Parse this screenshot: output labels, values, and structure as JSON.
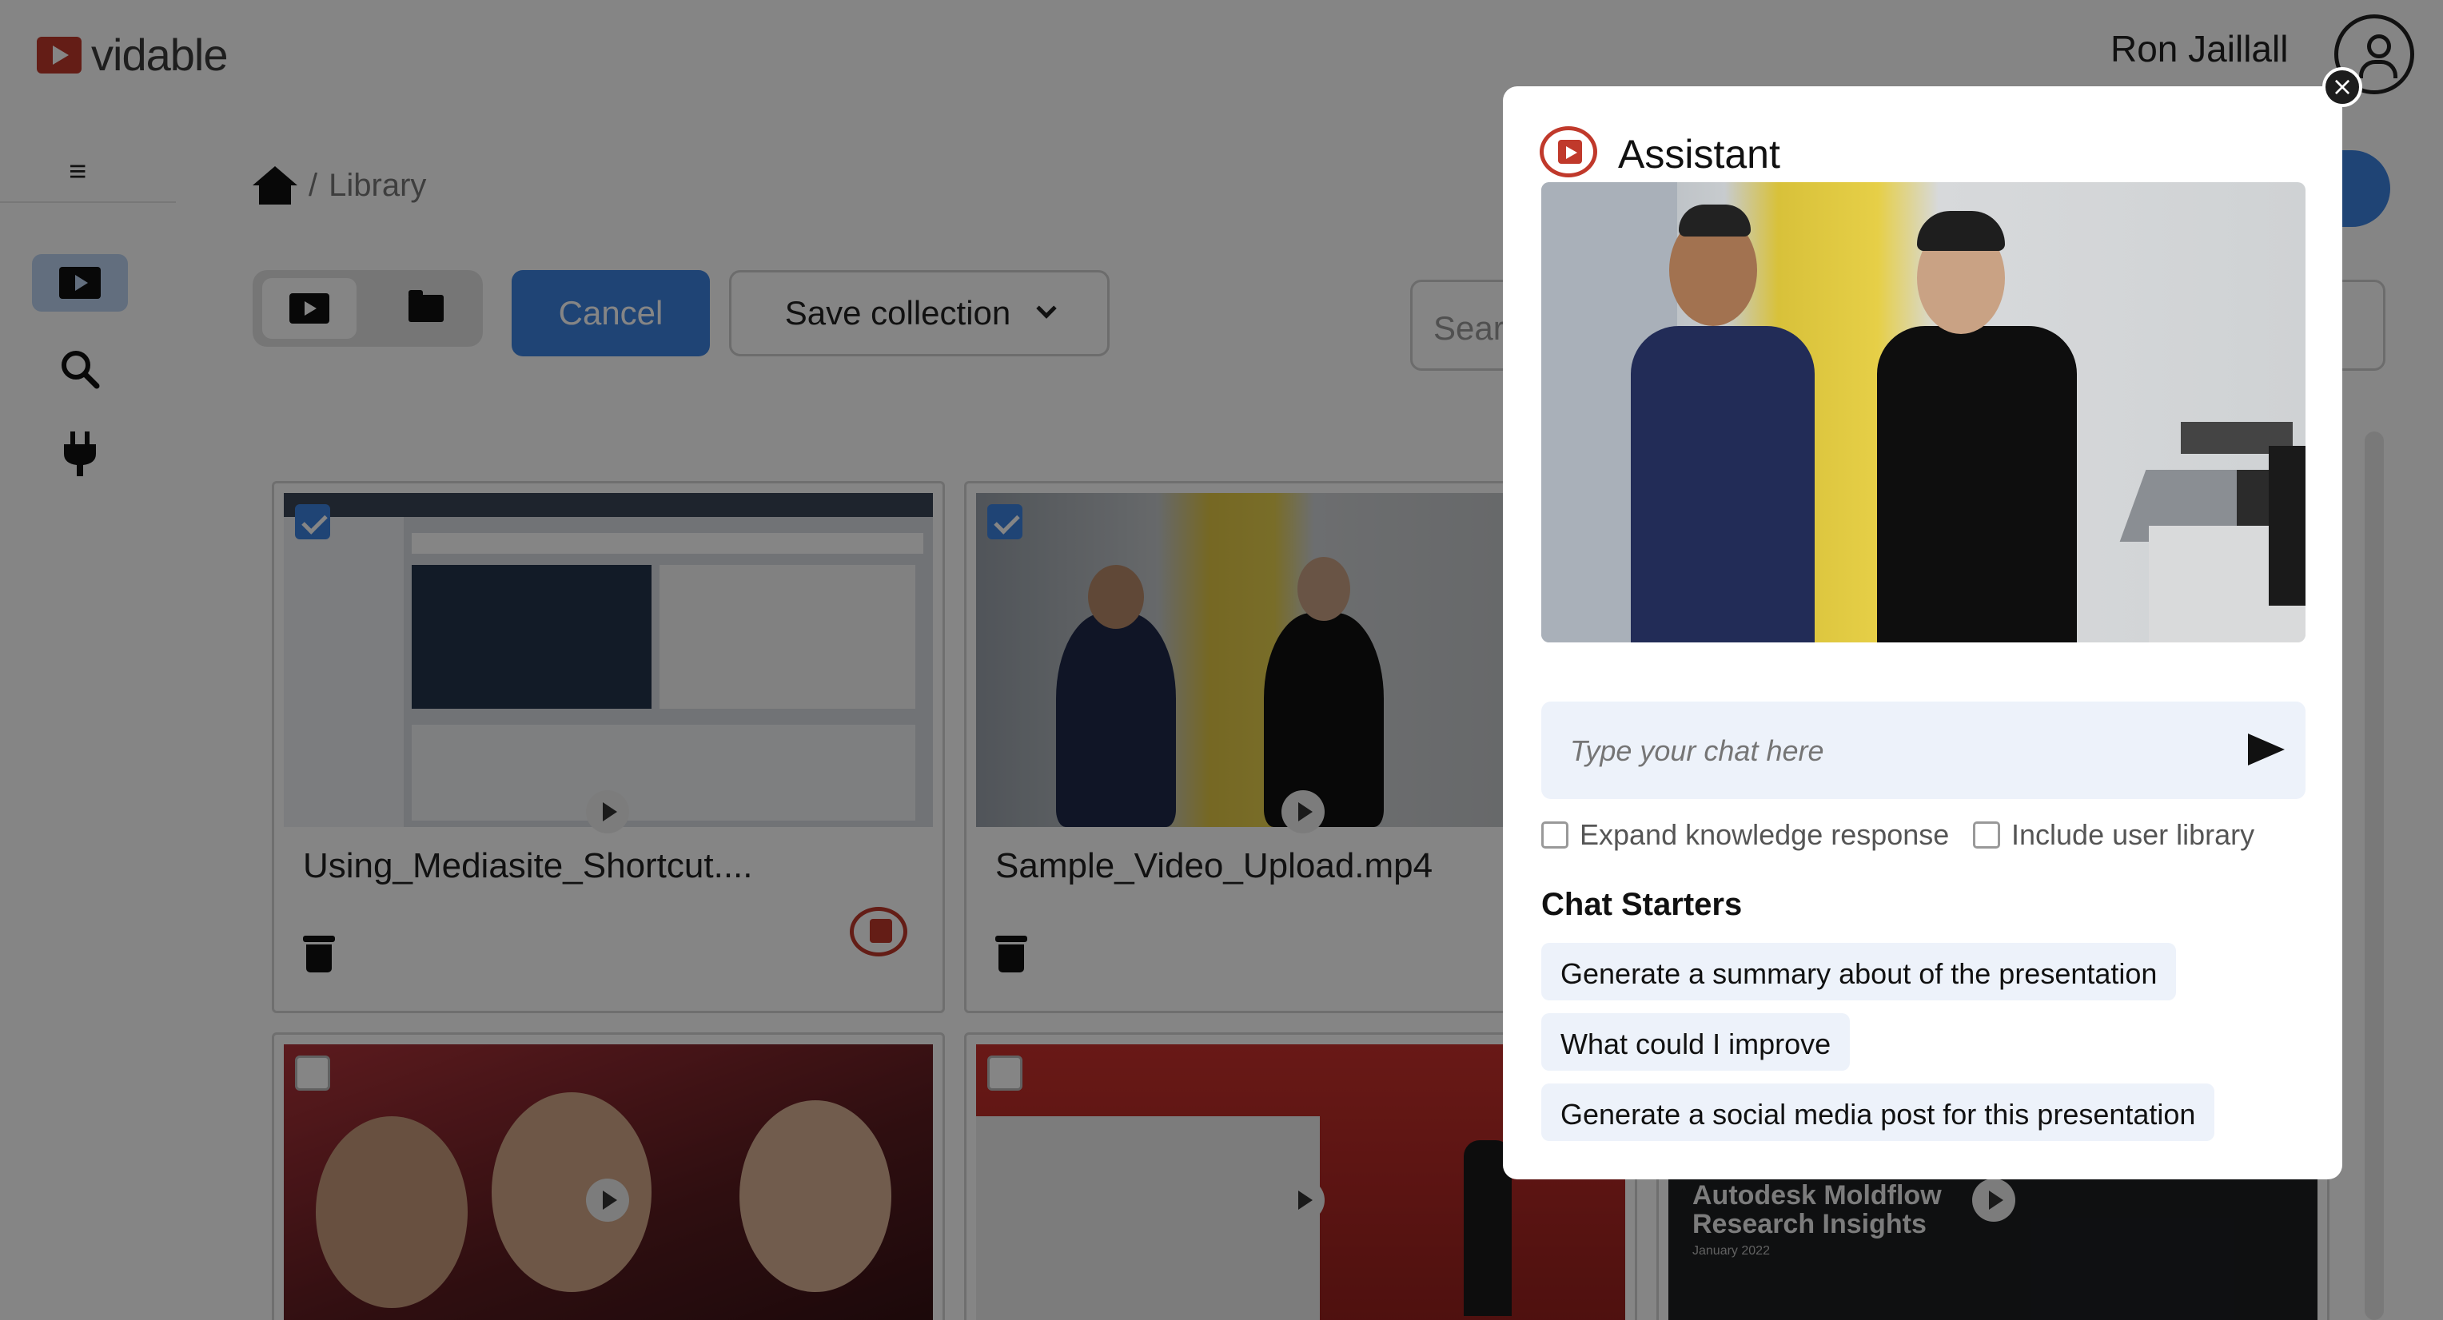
{
  "brand": {
    "name": "vidable"
  },
  "header": {
    "user_name": "Ron Jaillall"
  },
  "breadcrumb": {
    "current": "Library",
    "separator": "/"
  },
  "toolbar": {
    "cancel_label": "Cancel",
    "save_label": "Save collection",
    "search_placeholder": "Sear"
  },
  "cards": [
    {
      "title": "Using_Mediasite_Shortcut....",
      "checked": true
    },
    {
      "title": "Sample_Video_Upload.mp4",
      "checked": true
    },
    {
      "title": "",
      "checked": false
    },
    {
      "title": "",
      "checked": false
    }
  ],
  "third_row_text": {
    "line1": "Autodesk Moldflow",
    "line2": "Research Insights",
    "line3": "January 2022"
  },
  "assistant": {
    "title": "Assistant",
    "chat_placeholder": "Type your chat here",
    "options": [
      {
        "label": "Expand knowledge response",
        "checked": false
      },
      {
        "label": "Include user library",
        "checked": false
      }
    ],
    "starters_heading": "Chat Starters",
    "starters": [
      "Generate a summary about of the presentation",
      "What could I improve",
      "Generate a social media post for this presentation"
    ]
  },
  "colors": {
    "accent": "#3d82e0",
    "brand": "#c0392b"
  }
}
